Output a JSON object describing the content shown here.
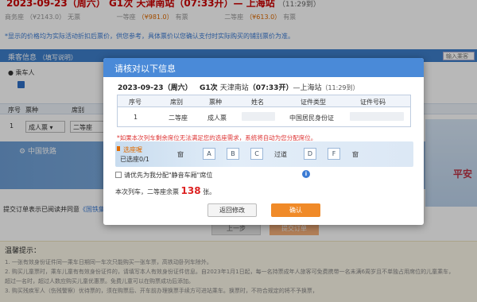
{
  "background": {
    "train_header": {
      "date": "2023-09-23（周六）",
      "train": "G1次",
      "route": "天津南站（07:33开）— 上海站",
      "duration": "（11:29到）"
    },
    "seat_row": [
      {
        "label": "商务座",
        "price": "（¥2143.0）",
        "status": "无票"
      },
      {
        "label": "一等座",
        "price": "（¥981.0）",
        "status": "有票"
      },
      {
        "label": "二等座",
        "price": "（¥613.0）",
        "status": "有票"
      }
    ],
    "notice": "*显示的价格均为实际活动折扣后票价，供您参考，具体票价以您确认支付时实际购买的铺别票价为准。",
    "passenger_section": {
      "title": "乘客信息",
      "subtitle": "（填写说明）",
      "search_placeholder": "输入乘客",
      "passenger_label": "乘车人"
    },
    "columns": {
      "seq": "序号",
      "ticket_type": "票种",
      "seat": "席别"
    },
    "row": {
      "seq": "1",
      "ticket_type": "成人票",
      "seat": "二等座"
    },
    "railway_logo": "中国铁路",
    "right_deco": "平安",
    "agreement": "提交订单表示已阅读并同意",
    "agreement_link": "《国铁集团铁路旅客运输规程》",
    "buttons": {
      "prev": "上一步",
      "submit": "提交订单"
    },
    "tips": {
      "title": "温馨提示：",
      "items": [
        "1. 一张有效身份证件同一乘车日期同一车次只能购买一张车票，高铁动卧列车除外。",
        "2. 购买儿童票时，乘车儿童有有效身份证件的，请填写本人有效身份证件信息。自2023年1月1日起，每一名持票成年人旅客可免费携带一名未满6周岁且不单独占用席位的儿童乘车，",
        "超过一名时，超过人数应购买儿童优惠票。免费儿童可以在购票成功后添加。",
        "3. 购买残疾军人（伤残警察）优待票的，须在购票后、开车前办理换票手续方可进站乘车。换票时，不符合规定的将不予换票，"
      ]
    }
  },
  "modal": {
    "title": "请核对以下信息",
    "train_line": {
      "date": "2023-09-23（周六）",
      "train": "G1次",
      "from": "天津南站",
      "depart": "（07:33开）",
      "arrow": "—",
      "to": "上海站",
      "arrive": "（11:29到）"
    },
    "table": {
      "headers": [
        "序号",
        "席别",
        "票种",
        "姓名",
        "证件类型",
        "证件号码"
      ],
      "rows": [
        {
          "seq": "1",
          "seat": "二等座",
          "ticket_type": "成人票",
          "name": "",
          "id_type": "中国居民身份证",
          "id_number": ""
        }
      ]
    },
    "warning": "*如果本次列车剩余席位无法满足您的选座需求，系统将自动为您分配席位。",
    "seat_selection": {
      "label": "选座喔",
      "count": "已选座0/1",
      "items": [
        "窗",
        "A",
        "B",
        "C",
        "过道",
        "D",
        "F",
        "窗"
      ]
    },
    "priority": {
      "label": "请优先为我分配\"静音车厢\"席位",
      "info_icon": "i"
    },
    "remaining": {
      "prefix": "本次列车，二等座余票",
      "count": "138",
      "suffix": "张。"
    },
    "buttons": {
      "back": "返回修改",
      "confirm": "确认"
    }
  }
}
